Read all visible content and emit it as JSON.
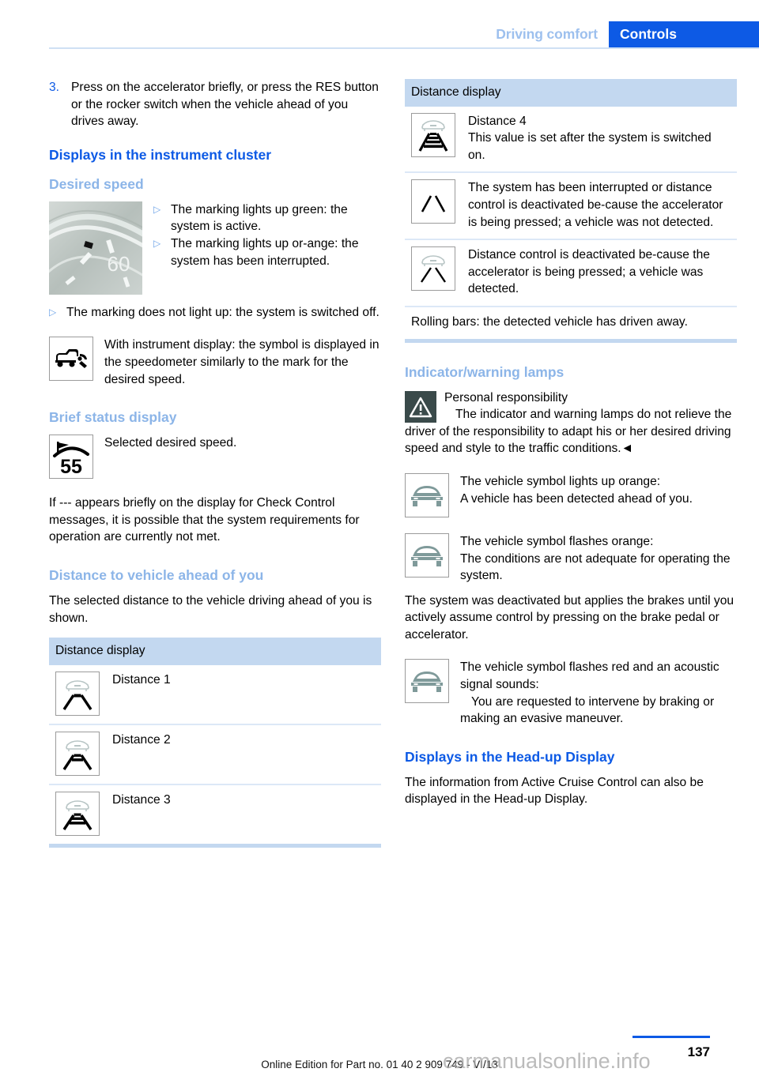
{
  "header": {
    "chapter": "Driving comfort",
    "section": "Controls"
  },
  "left": {
    "step": {
      "number": "3.",
      "text": "Press on the accelerator briefly, or press the RES button or the rocker switch when the vehicle ahead of you drives away."
    },
    "heading_cluster": "Displays in the instrument cluster",
    "heading_desired_speed": "Desired speed",
    "speedo_label": "60",
    "bullets": [
      "The marking lights up green: the system is active.",
      "The marking lights up or-ange: the system has been interrupted.",
      "The marking does not light up: the system is switched off."
    ],
    "acc_symbol_note": "With instrument display: the symbol is displayed in the speedometer similarly to the mark for the desired speed.",
    "heading_brief_status": "Brief status display",
    "brief_status_icon_value": "55",
    "brief_status_text": "Selected desired speed.",
    "check_control_text": "If --- appears briefly on the display for Check Control messages, it is possible that the system requirements for operation are currently not met.",
    "heading_distance": "Distance to vehicle ahead of you",
    "distance_intro": "The selected distance to the vehicle driving ahead of you is shown.",
    "table": {
      "header": "Distance display",
      "rows": [
        {
          "icon": "distance-1-icon",
          "bars": 1,
          "car": true,
          "text": "Distance 1"
        },
        {
          "icon": "distance-2-icon",
          "bars": 2,
          "car": true,
          "text": "Distance 2"
        },
        {
          "icon": "distance-3-icon",
          "bars": 3,
          "car": true,
          "text": "Distance 3"
        }
      ]
    }
  },
  "right": {
    "table": {
      "header": "Distance display",
      "rows": [
        {
          "icon": "distance-4-icon",
          "bars": 4,
          "car": true,
          "title": "Distance 4",
          "text": "This value is set after the system is switched on."
        },
        {
          "icon": "distance-interrupted-icon",
          "bars": 0,
          "car": false,
          "title": "",
          "text": "The system has been interrupted or distance control is deactivated be-cause the accelerator is being pressed; a vehicle was not detected."
        },
        {
          "icon": "distance-deactivated-icon",
          "bars": 0,
          "car": true,
          "title": "",
          "text": "Distance control is deactivated be-cause the accelerator is being pressed; a vehicle was detected."
        }
      ],
      "note": "Rolling bars: the detected vehicle has driven away."
    },
    "heading_lamps": "Indicator/warning lamps",
    "warning_title": "Personal responsibility",
    "warning_text": "The indicator and warning lamps do not relieve the driver of the responsibility to adapt his or her desired driving speed and style to the traffic conditions.◄",
    "lamps": [
      {
        "icon": "vehicle-symbol-icon",
        "title": "The vehicle symbol lights up orange:",
        "text": "A vehicle has been detected ahead of you."
      },
      {
        "icon": "vehicle-symbol-icon",
        "title": "The vehicle symbol flashes orange:",
        "text": "The conditions are not adequate for operating the system."
      }
    ],
    "deactivated_text": "The system was deactivated but applies the brakes until you actively assume control by pressing on the brake pedal or accelerator.",
    "red_lamp": {
      "icon": "vehicle-symbol-icon",
      "title": "The vehicle symbol flashes red and an acoustic signal sounds:",
      "text": "You are requested to intervene by braking or making an evasive maneuver."
    },
    "heading_hud": "Displays in the Head-up Display",
    "hud_text": "The information from Active Cruise Control can also be displayed in the Head-up Display."
  },
  "footer": {
    "page_number": "137",
    "edition": "Online Edition for Part no. 01 40 2 909 749 - VI/13",
    "watermark": "carmanualsonline.info"
  },
  "colors": {
    "accent_blue": "#0d5ae5",
    "light_blue": "#8cb5e8",
    "table_header": "#c3d8f0",
    "rule": "#dce8f7"
  }
}
